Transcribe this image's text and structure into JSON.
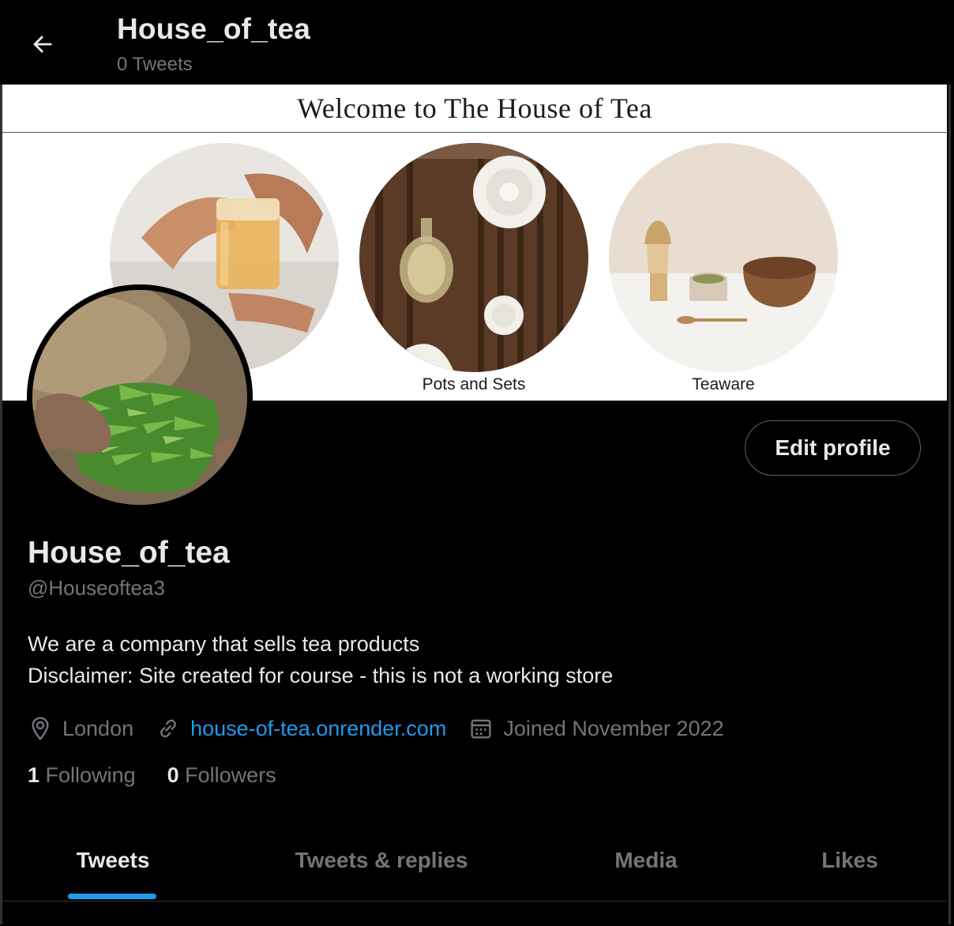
{
  "header": {
    "title": "House_of_tea",
    "tweet_count": "0 Tweets"
  },
  "banner": {
    "title": "Welcome to The House of Tea",
    "circles": [
      {
        "label": ""
      },
      {
        "label": "Pots and Sets"
      },
      {
        "label": "Teaware"
      }
    ]
  },
  "profile": {
    "edit_label": "Edit profile",
    "display_name": "House_of_tea",
    "handle": "@Houseoftea3",
    "bio": [
      "We are a company that sells tea products",
      "Disclaimer: Site created for course - this is not a working store"
    ],
    "location": "London",
    "website": "house-of-tea.onrender.com",
    "joined": "Joined November 2022",
    "following_count": "1",
    "following_label": "Following",
    "followers_count": "0",
    "followers_label": "Followers"
  },
  "tabs": [
    {
      "label": "Tweets",
      "active": true
    },
    {
      "label": "Tweets & replies",
      "active": false
    },
    {
      "label": "Media",
      "active": false
    },
    {
      "label": "Likes",
      "active": false
    }
  ],
  "colors": {
    "background": "#000000",
    "accent": "#1d9bf0",
    "muted_text": "#71767b",
    "primary_text": "#e7e9ea"
  },
  "icons": {
    "back": "arrow-left-icon",
    "location": "location-pin-icon",
    "link": "link-icon",
    "calendar": "calendar-icon"
  }
}
